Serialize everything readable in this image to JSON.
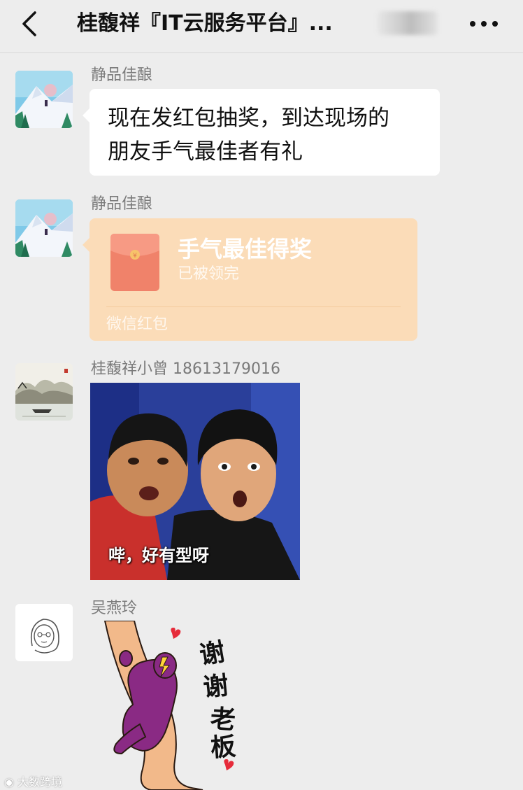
{
  "header": {
    "title": "桂馥祥『IT云服务平台』...",
    "back_icon": "chevron-left-icon",
    "more_icon": "more-dots-icon"
  },
  "messages": [
    {
      "sender": "静品佳酿",
      "avatar": "snow-mountain-avatar",
      "type": "text",
      "text_lines": [
        "现在发红包抽奖，到达现场的",
        "朋友手气最佳者有礼"
      ]
    },
    {
      "sender": "静品佳酿",
      "avatar": "snow-mountain-avatar",
      "type": "red-packet",
      "title": "手气最佳得奖",
      "status": "已被领完",
      "footer": "微信红包"
    },
    {
      "sender": "桂馥祥小曾 18613179016",
      "avatar": "landscape-painting-avatar",
      "type": "image",
      "caption": "哔，好有型呀"
    },
    {
      "sender": "吴燕玲",
      "avatar": "sketch-girl-avatar",
      "type": "sticker",
      "sticker_text": [
        "谢",
        "谢",
        "老",
        "板"
      ]
    }
  ],
  "watermark": "大数跨境",
  "colors": {
    "background": "#ededed",
    "bubble": "#ffffff",
    "red_packet": "#fbdcb8",
    "red_packet_icon": "#f0826a",
    "sender_text": "#7a7a7a"
  }
}
